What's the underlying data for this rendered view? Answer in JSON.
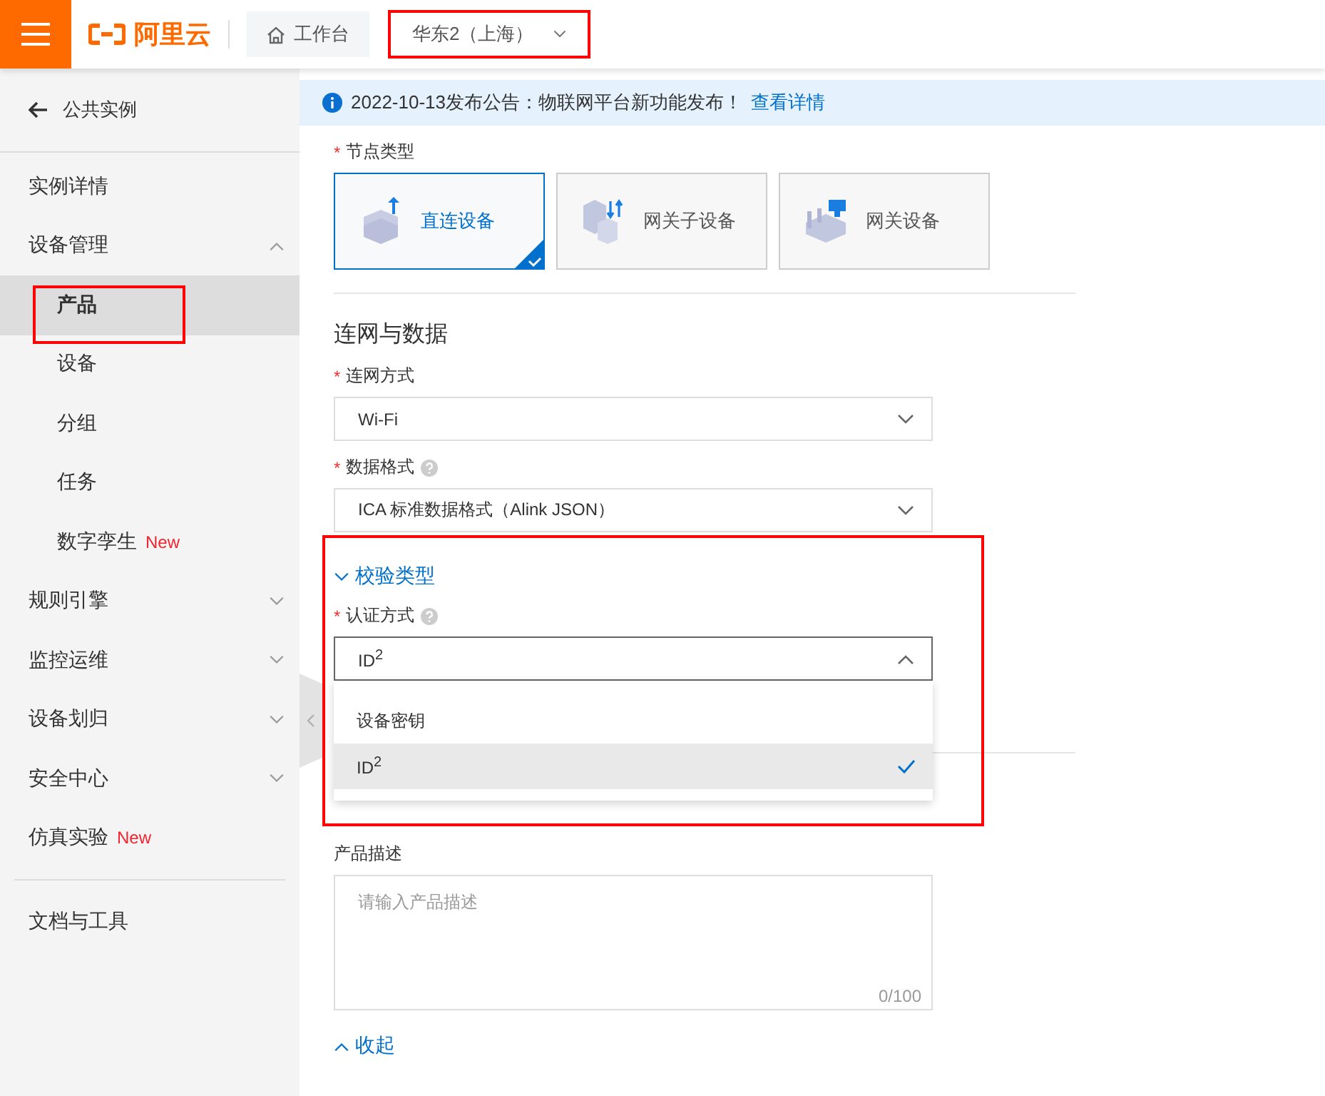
{
  "topbar": {
    "logo": "阿里云",
    "workbench": "工作台",
    "region": {
      "label": "华东2（上海）",
      "highlighted": true
    }
  },
  "sidebar": {
    "back": "公共实例",
    "items": [
      {
        "label": "实例详情",
        "kind": "link"
      },
      {
        "label": "设备管理",
        "kind": "group",
        "expanded": true,
        "children": [
          {
            "label": "产品",
            "selected": true,
            "highlighted": true
          },
          {
            "label": "设备",
            "selected": false,
            "highlighted": false
          },
          {
            "label": "分组",
            "selected": false,
            "highlighted": false
          },
          {
            "label": "任务",
            "selected": false,
            "highlighted": false
          },
          {
            "label": "数字孪生",
            "badge": "New",
            "selected": false,
            "highlighted": false
          }
        ]
      },
      {
        "label": "规则引擎",
        "kind": "group",
        "expanded": false
      },
      {
        "label": "监控运维",
        "kind": "group",
        "expanded": false
      },
      {
        "label": "设备划归",
        "kind": "group",
        "expanded": false
      },
      {
        "label": "安全中心",
        "kind": "group",
        "expanded": false
      },
      {
        "label": "仿真实验",
        "kind": "link",
        "badge": "New"
      }
    ],
    "footer": "文档与工具"
  },
  "notice": {
    "text": "2022-10-13发布公告：物联网平台新功能发布！",
    "link": "查看详情"
  },
  "node_type": {
    "label": "节点类型",
    "required_mark": "*",
    "options": [
      {
        "label": "直连设备",
        "kind": "direct",
        "selected": true
      },
      {
        "label": "网关子设备",
        "kind": "subdevice",
        "selected": false
      },
      {
        "label": "网关设备",
        "kind": "gateway",
        "selected": false
      }
    ]
  },
  "section_title": "连网与数据",
  "fields": [
    {
      "label": "连网方式",
      "required_mark": "*",
      "help": false,
      "value": "Wi-Fi"
    },
    {
      "label": "数据格式",
      "required_mark": "*",
      "help": true,
      "value": "ICA 标准数据格式（Alink JSON）"
    }
  ],
  "verification": {
    "title": "校验类型",
    "expanded": true,
    "highlighted": true,
    "field": {
      "label": "认证方式",
      "required_mark": "*",
      "help": true,
      "value": "ID$^{2}$",
      "open": true,
      "options": [
        {
          "label": "设备密钥",
          "selected": false
        },
        {
          "label": "ID$^{2}$",
          "selected": true
        }
      ]
    }
  },
  "description": {
    "label": "产品描述",
    "placeholder": "请输入产品描述",
    "counter": "0/100"
  },
  "collapse_link": "收起"
}
